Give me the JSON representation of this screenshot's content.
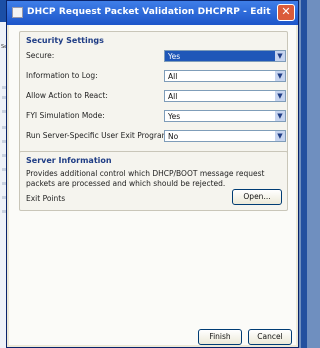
{
  "dialog": {
    "title": "DHCP Request Packet Validation DHCPRP - Edit",
    "close_glyph": "✕"
  },
  "background": {
    "side_label": "Secur"
  },
  "security": {
    "heading": "Security Settings",
    "rows": [
      {
        "label": "Secure:",
        "value": "Yes",
        "selected": true
      },
      {
        "label": "Information to Log:",
        "value": "All",
        "selected": false
      },
      {
        "label": "Allow Action to React:",
        "value": "All",
        "selected": false
      },
      {
        "label": "FYI Simulation Mode:",
        "value": "Yes",
        "selected": false
      },
      {
        "label": "Run Server-Specific User Exit Program:",
        "value": "No",
        "selected": false
      }
    ]
  },
  "server_info": {
    "heading": "Server Information",
    "description": "Provides additional control which DHCP/BOOT message request packets are processed and which should be rejected.",
    "exit_points_label": "Exit Points",
    "open_label": "Open..."
  },
  "footer": {
    "finish_label": "Finish",
    "cancel_label": "Cancel"
  },
  "colors": {
    "titlebar": "#1d56c9",
    "selected": "#1f57b8",
    "heading": "#1f3d85",
    "close": "#db5b3a"
  },
  "icons": {
    "close": "close-icon",
    "dropdown": "chevron-down-icon",
    "app": "window-icon"
  }
}
